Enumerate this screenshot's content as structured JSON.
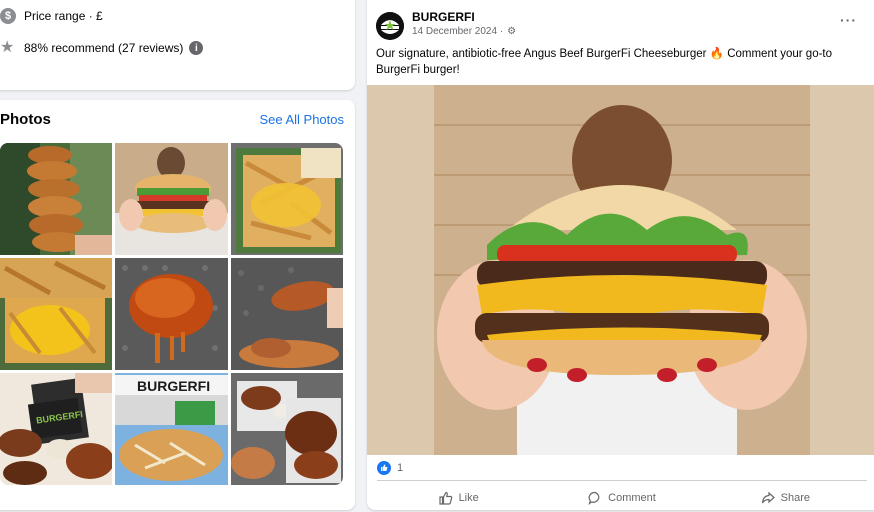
{
  "info": {
    "price_icon": "dollar-icon",
    "price_text": "Price range · £",
    "recommend_icon": "star-icon",
    "recommend_text": "88% recommend (27 reviews)",
    "info_icon": "i"
  },
  "photos": {
    "title": "Photos",
    "see_all": "See All Photos",
    "items": [
      "onion-rings-tower-photo",
      "cheeseburger-held-photo",
      "cheese-fries-tray-photo",
      "cheese-fries-closeup-photo",
      "glazed-chicken-drip-photo",
      "chicken-tenders-photo",
      "gift-card-wings-photo",
      "burgerfi-storefront-fries-photo",
      "wings-baskets-photo"
    ],
    "storefront_sign": "BURGERFI"
  },
  "post": {
    "page_name": "BURGERFI",
    "date": "14 December 2024 ·",
    "more": "···",
    "text": "Our signature, antibiotic-free Angus Beef BurgerFi Cheeseburger 🔥 Comment your go-to BurgerFi burger!",
    "reaction_count": "1",
    "actions": {
      "like": "Like",
      "comment": "Comment",
      "share": "Share"
    }
  },
  "colors": {
    "link_blue": "#1b74e4",
    "like_blue": "#1877f2",
    "muted_text": "#65676b",
    "background": "#f0f2f5"
  }
}
